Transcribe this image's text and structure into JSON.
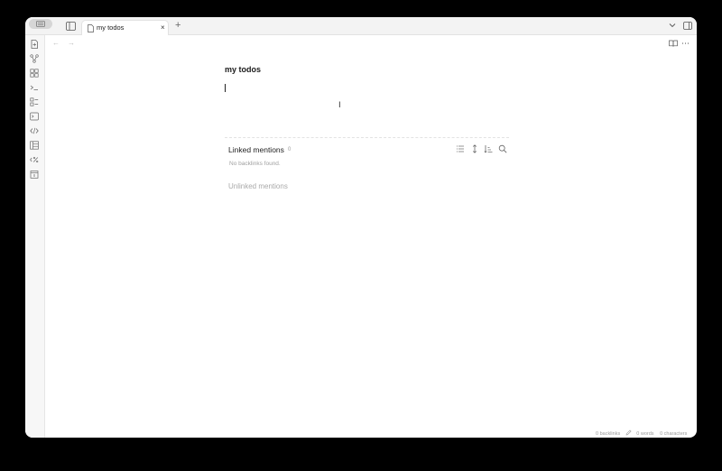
{
  "tabs": [
    {
      "label": "my todos",
      "close": "×"
    }
  ],
  "new_tab": "+",
  "nav": {
    "back": "←",
    "forward": "→",
    "more": "⋯"
  },
  "note": {
    "title": "my todos"
  },
  "backlinks": {
    "linked_title": "Linked mentions",
    "linked_count": "0",
    "empty": "No backlinks found.",
    "unlinked_title": "Unlinked mentions"
  },
  "status": {
    "backlinks": "0 backlinks",
    "words": "0 words",
    "characters": "0 characters"
  },
  "ribbon_icons": [
    "new-note-icon",
    "graph-icon",
    "canvas-icon",
    "terminal-icon",
    "command-palette-icon",
    "console-icon",
    "code-icon",
    "templates-icon",
    "percent-icon",
    "calendar-icon"
  ],
  "colors": {
    "background": "#000000",
    "window": "#ffffff",
    "sidebar": "#f7f7f7",
    "muted_text": "#a0a0a0"
  }
}
